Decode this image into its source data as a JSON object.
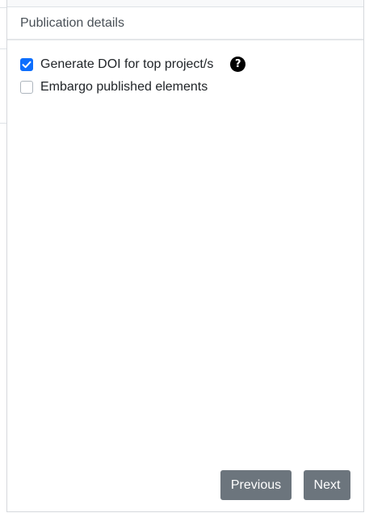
{
  "section": {
    "title": "Publication details"
  },
  "options": {
    "generate_doi": {
      "label": "Generate DOI for top project/s",
      "checked": true,
      "help_icon": "question-circle-icon"
    },
    "embargo": {
      "label": "Embargo published elements",
      "checked": false
    }
  },
  "footer": {
    "previous_label": "Previous",
    "next_label": "Next"
  },
  "colors": {
    "checkbox_checked": "#0d6efd",
    "button_secondary": "#6c757d",
    "header_text": "#495057"
  }
}
